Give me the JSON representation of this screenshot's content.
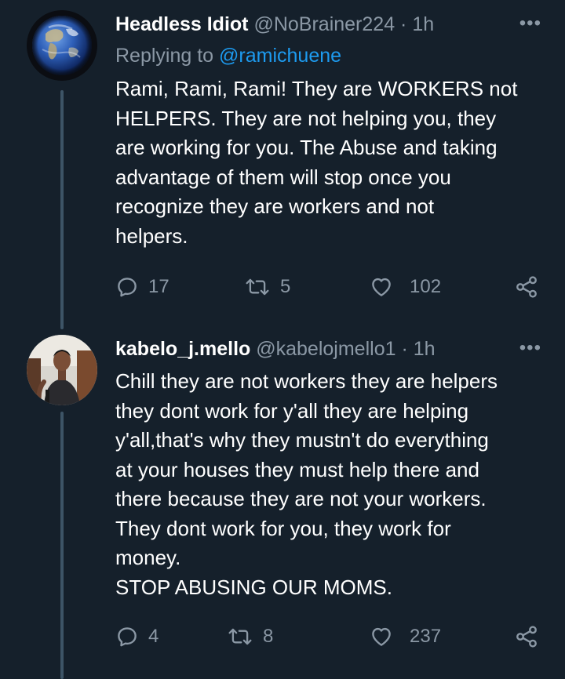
{
  "tweets": [
    {
      "display_name": "Headless Idiot",
      "handle": "@NoBrainer224",
      "separator": "·",
      "time": "1h",
      "more_label": "•••",
      "reply_prefix": "Replying to",
      "reply_mention": "@ramichuene",
      "text": "Rami, Rami, Rami! They are WORKERS not\nHELPERS. They are not helping you, they\nare working for you. The Abuse and taking\nadvantage of them will stop once you\nrecognize they are workers and not\nhelpers.",
      "replies": "17",
      "retweets": "5",
      "likes": "102"
    },
    {
      "display_name": "kabelo_j.mello",
      "handle": "@kabelojmello1",
      "separator": "·",
      "time": "1h",
      "more_label": "•••",
      "text": "Chill they are not workers they are helpers\nthey dont work for y'all they are helping\ny'all,that's why they mustn't do everything\nat your houses they must help there and\nthere because they are not your workers.\nThey dont work for you, they work for\nmoney.\nSTOP ABUSING OUR MOMS.",
      "replies": "4",
      "retweets": "8",
      "likes": "237"
    }
  ],
  "colors": {
    "background": "#15202b",
    "secondary_text": "#8b98a5",
    "link": "#1d9bf0",
    "thread_line": "#3d5466"
  },
  "icons": {
    "reply": "reply-icon",
    "retweet": "retweet-icon",
    "like": "heart-icon",
    "share": "share-icon",
    "more": "more-options-icon"
  }
}
